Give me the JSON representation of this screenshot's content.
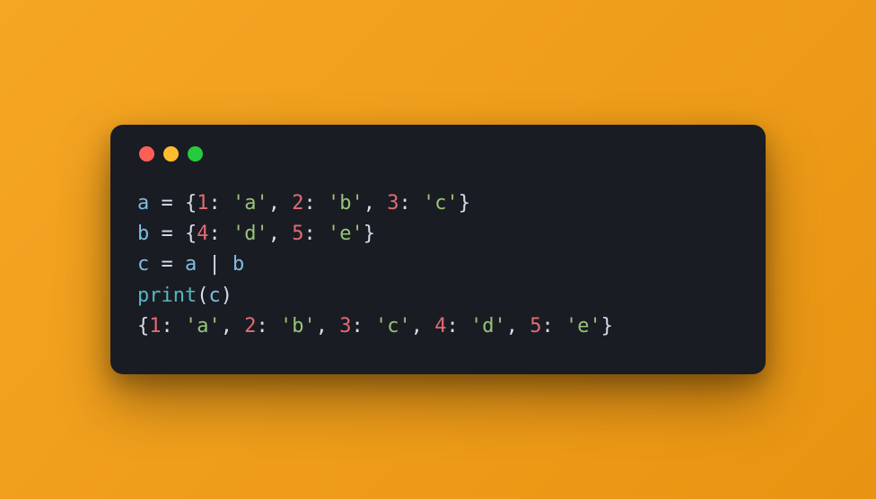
{
  "colors": {
    "background_gradient_start": "#f5a623",
    "background_gradient_end": "#e89412",
    "terminal_bg": "#1a1c23",
    "traffic_red": "#ff5f56",
    "traffic_yellow": "#ffbd2e",
    "traffic_green": "#27c93f",
    "code_default": "#d6deeb",
    "code_variable": "#7fbde0",
    "code_number": "#e06c75",
    "code_string": "#98c379",
    "code_function": "#56b6c2"
  },
  "code_lines": [
    [
      {
        "cls": "tok-var",
        "t": "a"
      },
      {
        "cls": "tok-op",
        "t": " = "
      },
      {
        "cls": "tok-punct",
        "t": "{"
      },
      {
        "cls": "tok-num",
        "t": "1"
      },
      {
        "cls": "tok-punct",
        "t": ": "
      },
      {
        "cls": "tok-str",
        "t": "'a'"
      },
      {
        "cls": "tok-punct",
        "t": ", "
      },
      {
        "cls": "tok-num",
        "t": "2"
      },
      {
        "cls": "tok-punct",
        "t": ": "
      },
      {
        "cls": "tok-str",
        "t": "'b'"
      },
      {
        "cls": "tok-punct",
        "t": ", "
      },
      {
        "cls": "tok-num",
        "t": "3"
      },
      {
        "cls": "tok-punct",
        "t": ": "
      },
      {
        "cls": "tok-str",
        "t": "'c'"
      },
      {
        "cls": "tok-punct",
        "t": "}"
      }
    ],
    [
      {
        "cls": "tok-var",
        "t": "b"
      },
      {
        "cls": "tok-op",
        "t": " = "
      },
      {
        "cls": "tok-punct",
        "t": "{"
      },
      {
        "cls": "tok-num",
        "t": "4"
      },
      {
        "cls": "tok-punct",
        "t": ": "
      },
      {
        "cls": "tok-str",
        "t": "'d'"
      },
      {
        "cls": "tok-punct",
        "t": ", "
      },
      {
        "cls": "tok-num",
        "t": "5"
      },
      {
        "cls": "tok-punct",
        "t": ": "
      },
      {
        "cls": "tok-str",
        "t": "'e'"
      },
      {
        "cls": "tok-punct",
        "t": "}"
      }
    ],
    [
      {
        "cls": "tok-var",
        "t": "c"
      },
      {
        "cls": "tok-op",
        "t": " = "
      },
      {
        "cls": "tok-var",
        "t": "a"
      },
      {
        "cls": "tok-op",
        "t": " | "
      },
      {
        "cls": "tok-var",
        "t": "b"
      }
    ],
    [
      {
        "cls": "tok-func",
        "t": "print"
      },
      {
        "cls": "tok-punct",
        "t": "("
      },
      {
        "cls": "tok-var",
        "t": "c"
      },
      {
        "cls": "tok-punct",
        "t": ")"
      }
    ],
    [
      {
        "cls": "tok-punct",
        "t": "{"
      },
      {
        "cls": "tok-num",
        "t": "1"
      },
      {
        "cls": "tok-punct",
        "t": ": "
      },
      {
        "cls": "tok-str",
        "t": "'a'"
      },
      {
        "cls": "tok-punct",
        "t": ", "
      },
      {
        "cls": "tok-num",
        "t": "2"
      },
      {
        "cls": "tok-punct",
        "t": ": "
      },
      {
        "cls": "tok-str",
        "t": "'b'"
      },
      {
        "cls": "tok-punct",
        "t": ", "
      },
      {
        "cls": "tok-num",
        "t": "3"
      },
      {
        "cls": "tok-punct",
        "t": ": "
      },
      {
        "cls": "tok-str",
        "t": "'c'"
      },
      {
        "cls": "tok-punct",
        "t": ", "
      },
      {
        "cls": "tok-num",
        "t": "4"
      },
      {
        "cls": "tok-punct",
        "t": ": "
      },
      {
        "cls": "tok-str",
        "t": "'d'"
      },
      {
        "cls": "tok-punct",
        "t": ", "
      },
      {
        "cls": "tok-num",
        "t": "5"
      },
      {
        "cls": "tok-punct",
        "t": ": "
      },
      {
        "cls": "tok-str",
        "t": "'e'"
      },
      {
        "cls": "tok-punct",
        "t": "}"
      }
    ]
  ]
}
